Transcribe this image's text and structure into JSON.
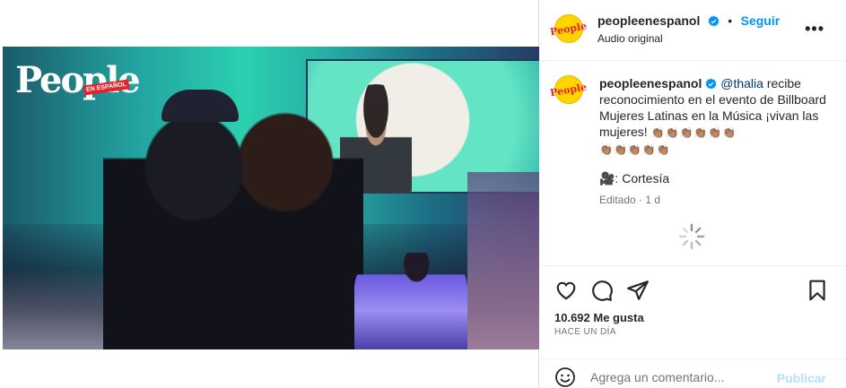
{
  "video": {
    "logo_text": "People",
    "logo_badge": "EN ESPAÑOL",
    "mute_icon": "speaker-muted-icon"
  },
  "header": {
    "username": "peopleenespanol",
    "separator": "•",
    "follow_label": "Seguir",
    "audio_label": "Audio original",
    "more_icon": "more-options-icon",
    "more_label": "•••",
    "avatar_text": "People"
  },
  "caption": {
    "username": "peopleenespanol",
    "mention": "@thalia",
    "text": " recibe reconocimiento en el evento de Billboard Mujeres Latinas en la Música ¡vivan las mujeres! ",
    "emojis_line1": "👏🏽👏🏽👏🏽👏🏽👏🏽👏🏽",
    "emojis_line2": "👏🏽👏🏽👏🏽👏🏽👏🏽",
    "credit": "🎥: Cortesía",
    "meta": "Editado · 1 d"
  },
  "actions": {
    "likes": "10.692 Me gusta",
    "time_ago": "HACE UN DÍA"
  },
  "comment": {
    "placeholder": "Agrega un comentario...",
    "publish_label": "Publicar"
  },
  "colors": {
    "link_blue": "#0095f6",
    "mention_blue": "#00376b",
    "verified_blue": "#0095f6",
    "people_yellow": "#ffd400",
    "people_red": "#e0252d"
  }
}
